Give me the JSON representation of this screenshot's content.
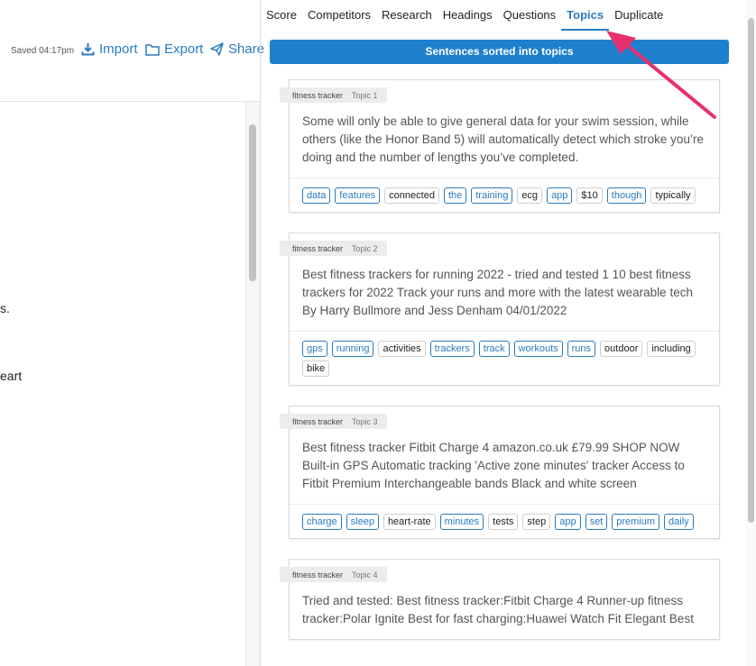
{
  "editor": {
    "saved_text": "Saved 04:17pm",
    "import_label": "Import",
    "export_label": "Export",
    "share_label": "Share",
    "fragments": [
      "s.",
      "eart"
    ]
  },
  "tabs": [
    {
      "label": "Score"
    },
    {
      "label": "Competitors"
    },
    {
      "label": "Research"
    },
    {
      "label": "Headings"
    },
    {
      "label": "Questions"
    },
    {
      "label": "Topics"
    },
    {
      "label": "Duplicate"
    }
  ],
  "banner": "Sentences sorted into topics",
  "cards": [
    {
      "keyword": "fitness tracker",
      "topic": "Topic 1",
      "text": "Some will only be able to give general data for your swim session, while others (like the Honor Band 5) will automatically detect which stroke you’re doing and the number of lengths you’ve completed.",
      "keywords": [
        {
          "w": "data",
          "hl": true
        },
        {
          "w": "features",
          "hl": true
        },
        {
          "w": "connected",
          "hl": false
        },
        {
          "w": "the",
          "hl": true
        },
        {
          "w": "training",
          "hl": true
        },
        {
          "w": "ecg",
          "hl": false
        },
        {
          "w": "app",
          "hl": true
        },
        {
          "w": "$10",
          "hl": false
        },
        {
          "w": "though",
          "hl": true
        },
        {
          "w": "typically",
          "hl": false
        }
      ]
    },
    {
      "keyword": "fitness tracker",
      "topic": "Topic 2",
      "text": "Best fitness trackers for running 2022 - tried and tested 1 10 best fitness trackers for 2022 Track your runs and more with the latest wearable tech By Harry Bullmore and Jess Denham 04/01/2022",
      "keywords": [
        {
          "w": "gps",
          "hl": true
        },
        {
          "w": "running",
          "hl": true
        },
        {
          "w": "activities",
          "hl": false
        },
        {
          "w": "trackers",
          "hl": true
        },
        {
          "w": "track",
          "hl": true
        },
        {
          "w": "workouts",
          "hl": true
        },
        {
          "w": "runs",
          "hl": true
        },
        {
          "w": "outdoor",
          "hl": false
        },
        {
          "w": "including",
          "hl": false
        },
        {
          "w": "bike",
          "hl": false
        }
      ]
    },
    {
      "keyword": "fitness tracker",
      "topic": "Topic 3",
      "text": "Best fitness tracker Fitbit Charge 4 amazon.co.uk £79.99 SHOP NOW Built-in GPS Automatic tracking 'Active zone minutes' tracker Access to Fitbit Premium Interchangeable bands Black and white screen",
      "keywords": [
        {
          "w": "charge",
          "hl": true
        },
        {
          "w": "sleep",
          "hl": true
        },
        {
          "w": "heart-rate",
          "hl": false
        },
        {
          "w": "minutes",
          "hl": true
        },
        {
          "w": "tests",
          "hl": false
        },
        {
          "w": "step",
          "hl": false
        },
        {
          "w": "app",
          "hl": true
        },
        {
          "w": "set",
          "hl": true
        },
        {
          "w": "premium",
          "hl": true
        },
        {
          "w": "daily",
          "hl": true
        }
      ]
    },
    {
      "keyword": "fitness tracker",
      "topic": "Topic 4",
      "text": "Tried and tested: Best fitness tracker:Fitbit Charge 4 Runner-up fitness tracker:Polar Ignite Best for fast charging:Huawei Watch Fit Elegant Best",
      "keywords": []
    }
  ],
  "colors": {
    "accent": "#1e80cc",
    "link": "#2a7bc0",
    "arrow": "#e8306f"
  }
}
